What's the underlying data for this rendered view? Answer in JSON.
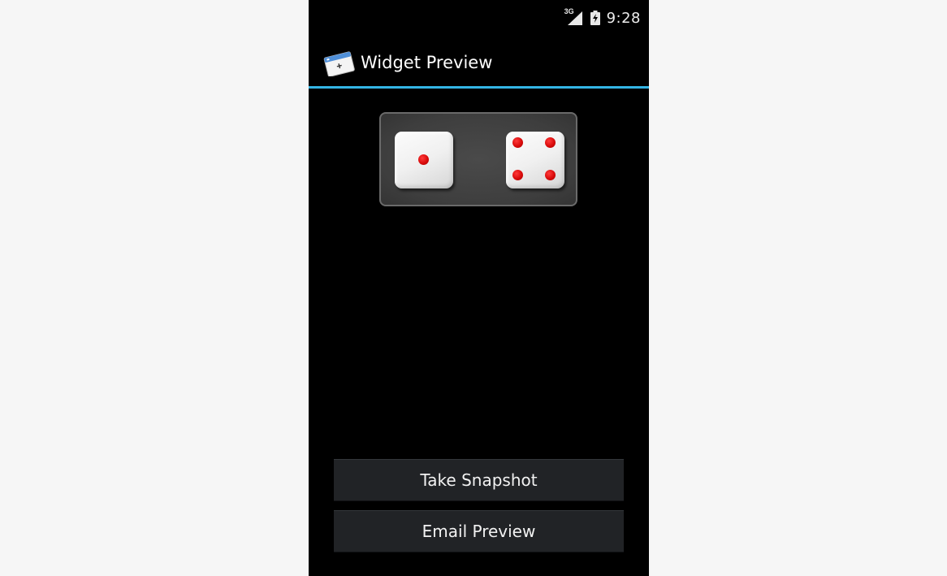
{
  "status_bar": {
    "network_type": "3G",
    "signal_icon": "signal-icon",
    "battery_icon": "battery-charging-icon",
    "time": "9:28"
  },
  "action_bar": {
    "app_icon": "widget-preview-app-icon",
    "title": "Widget Preview",
    "accent_color": "#33b5e5"
  },
  "widget_preview": {
    "dice": [
      {
        "name": "left-die",
        "value": 1
      },
      {
        "name": "right-die",
        "value": 4
      }
    ],
    "pip_color": "#d90b0b"
  },
  "buttons": {
    "take_snapshot": "Take Snapshot",
    "email_preview": "Email Preview"
  }
}
